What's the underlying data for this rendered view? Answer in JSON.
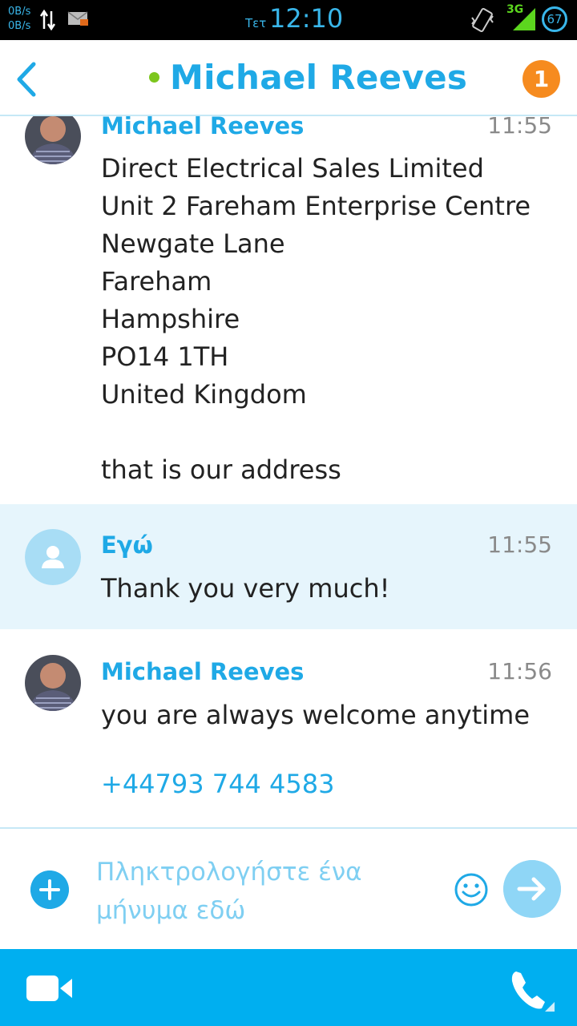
{
  "status_bar": {
    "rate_up": "0B/s",
    "rate_down": "0B/s",
    "day": "Τετ",
    "time": "12:10",
    "network": "3G",
    "battery": "67"
  },
  "header": {
    "title": "Michael Reeves",
    "notification_count": "1",
    "presence": "online"
  },
  "messages": [
    {
      "sender": "Michael Reeves",
      "time": "11:55",
      "text": "Direct Electrical Sales Limited\nUnit 2 Fareham Enterprise Centre\nNewgate Lane\nFareham\nHampshire\nPO14 1TH\nUnited Kingdom\n\nthat is our address"
    },
    {
      "sender": "Εγώ",
      "time": "11:55",
      "text": "Thank you very much!"
    },
    {
      "sender": "Michael Reeves",
      "time": "11:56",
      "text": "you are always welcome anytime",
      "link": "+44793 744 4583"
    }
  ],
  "composer": {
    "placeholder": "Πληκτρολογήστε ένα μήνυμα εδώ"
  },
  "icons": {
    "back": "chevron-left-icon",
    "add": "plus-icon",
    "emoji": "smiley-icon",
    "send": "arrow-right-icon",
    "video": "video-camera-icon",
    "call": "phone-icon"
  },
  "colors": {
    "accent": "#1fa9e6",
    "bottom_bar": "#00aff0",
    "badge": "#f68b1f",
    "presence": "#7cc61d",
    "self_message_bg": "#e6f5fc"
  }
}
